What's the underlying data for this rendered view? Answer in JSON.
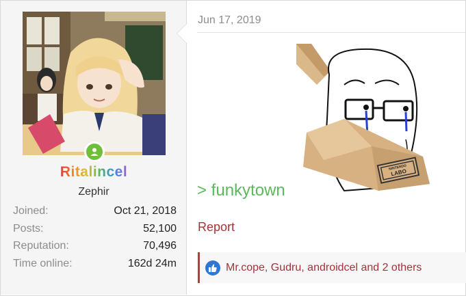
{
  "user": {
    "name": "Ritalincel",
    "title": "Zephir",
    "stats": [
      {
        "label": "Joined:",
        "value": "Oct 21, 2018"
      },
      {
        "label": "Posts:",
        "value": "52,100"
      },
      {
        "label": "Reputation:",
        "value": "70,496"
      },
      {
        "label": "Time online:",
        "value": "162d 24m"
      }
    ]
  },
  "post": {
    "date": "Jun 17, 2019",
    "greentext": "> funkytown",
    "report_label": "Report",
    "likes_text": "Mr.cope, Gudru, androidcel and 2 others",
    "meme_box_text": "NINTENDO LABO"
  },
  "colors": {
    "greentext": "#5cb85c",
    "link": "#a5333a",
    "online": "#6fbf3a",
    "like": "#2f77d3"
  }
}
